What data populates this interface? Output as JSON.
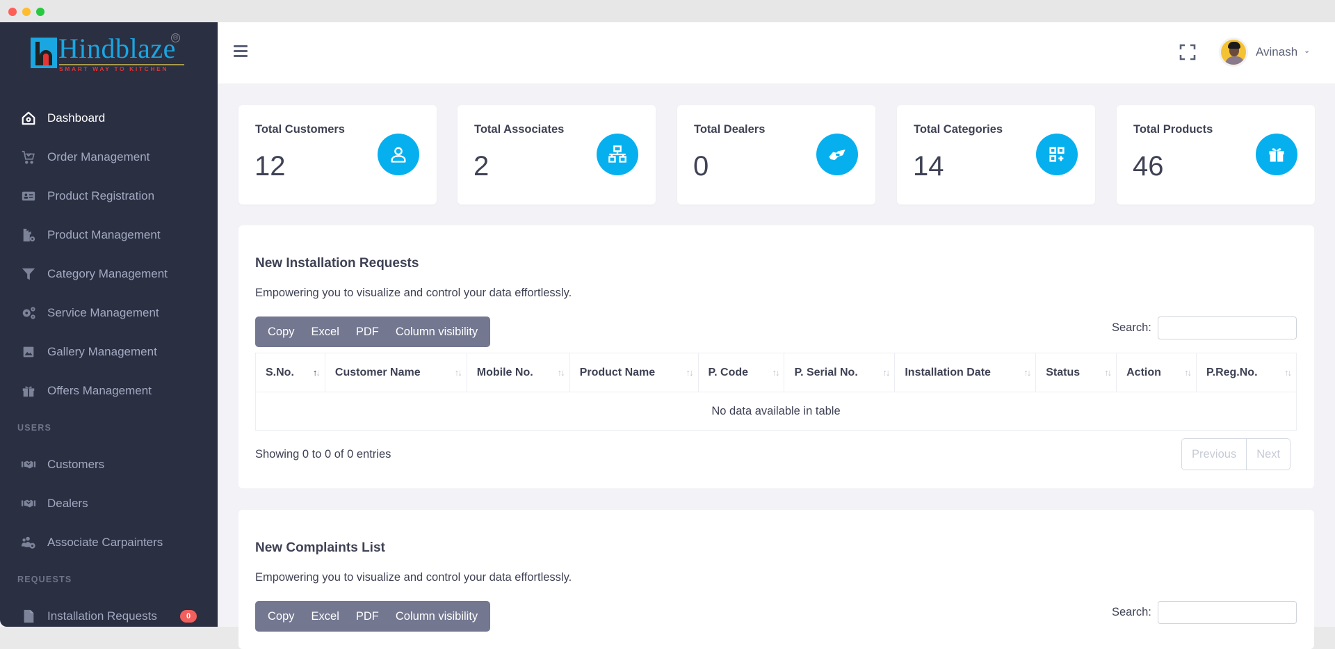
{
  "window": {
    "traffic_lights": [
      "close",
      "minimize",
      "maximize"
    ]
  },
  "brand": {
    "name": "Hindblaze",
    "tagline": "SMART WAY TO KITCHEN",
    "registered_mark": "®",
    "colors": {
      "primary": "#1aa6e0",
      "accent": "#e53434"
    }
  },
  "sidebar": {
    "items": [
      {
        "label": "Dashboard",
        "icon": "home-icon",
        "active": true
      },
      {
        "label": "Order Management",
        "icon": "cart-icon"
      },
      {
        "label": "Product Registration",
        "icon": "id-card-icon"
      },
      {
        "label": "Product Management",
        "icon": "product-gear-icon"
      },
      {
        "label": "Category Management",
        "icon": "filter-icon"
      },
      {
        "label": "Service Management",
        "icon": "gears-icon"
      },
      {
        "label": "Gallery Management",
        "icon": "image-icon"
      },
      {
        "label": "Offers Management",
        "icon": "gift-icon"
      }
    ],
    "users_section": "USERS",
    "users_items": [
      {
        "label": "Customers",
        "icon": "handshake-icon"
      },
      {
        "label": "Dealers",
        "icon": "handshake-icon"
      },
      {
        "label": "Associate Carpainters",
        "icon": "users-cog-icon"
      }
    ],
    "requests_section": "REQUESTS",
    "requests_items": [
      {
        "label": "Installation Requests",
        "icon": "file-icon",
        "badge": "0"
      }
    ]
  },
  "header": {
    "menu_icon": "hamburger-icon",
    "fullscreen_icon": "expand-icon",
    "user_name": "Avinash",
    "user_caret": "⌄"
  },
  "stats": [
    {
      "label": "Total Customers",
      "value": "12",
      "icon": "user-icon"
    },
    {
      "label": "Total Associates",
      "value": "2",
      "icon": "network-icon"
    },
    {
      "label": "Total Dealers",
      "value": "0",
      "icon": "handshake-icon"
    },
    {
      "label": "Total Categories",
      "value": "14",
      "icon": "grid-plus-icon"
    },
    {
      "label": "Total Products",
      "value": "46",
      "icon": "gift-icon"
    }
  ],
  "stat_icon_color": "#06b0ef",
  "installation_panel": {
    "title": "New Installation Requests",
    "subtitle": "Empowering you to visualize and control your data effortlessly.",
    "buttons": [
      "Copy",
      "Excel",
      "PDF",
      "Column visibility"
    ],
    "search_label": "Search:",
    "search_value": "",
    "columns": [
      "S.No.",
      "Customer Name",
      "Mobile No.",
      "Product Name",
      "P. Code",
      "P. Serial No.",
      "Installation Date",
      "Status",
      "Action",
      "P.Reg.No."
    ],
    "sorted_column": "S.No.",
    "empty_message": "No data available in table",
    "info": "Showing 0 to 0 of 0 entries",
    "pager": {
      "previous": "Previous",
      "next": "Next"
    }
  },
  "complaints_panel": {
    "title": "New Complaints List",
    "subtitle": "Empowering you to visualize and control your data effortlessly.",
    "buttons": [
      "Copy",
      "Excel",
      "PDF",
      "Column visibility"
    ],
    "search_label": "Search:",
    "search_value": ""
  }
}
